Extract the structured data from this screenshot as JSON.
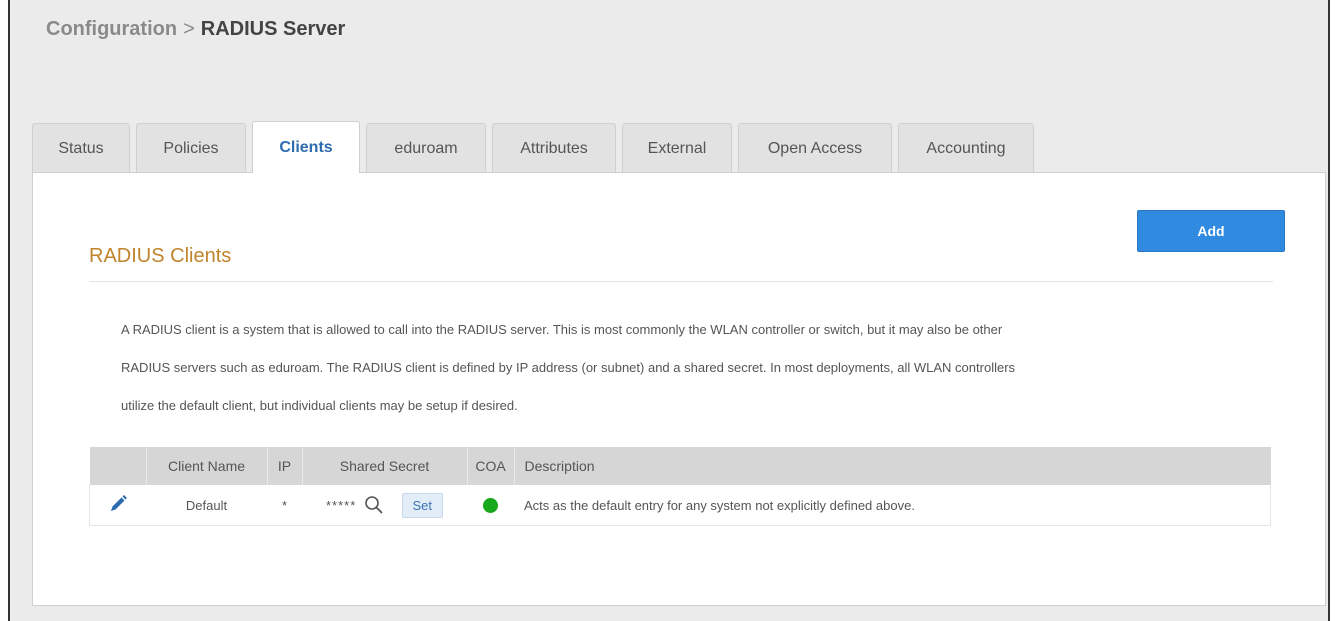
{
  "breadcrumb": {
    "parent": "Configuration",
    "separator": ">",
    "current": "RADIUS Server"
  },
  "tabs": [
    {
      "label": "Status",
      "active": false
    },
    {
      "label": "Policies",
      "active": false
    },
    {
      "label": "Clients",
      "active": true
    },
    {
      "label": "eduroam",
      "active": false
    },
    {
      "label": "Attributes",
      "active": false
    },
    {
      "label": "External",
      "active": false
    },
    {
      "label": "Open Access",
      "active": false
    },
    {
      "label": "Accounting",
      "active": false
    }
  ],
  "panel": {
    "add_label": "Add",
    "title": "RADIUS Clients",
    "description": [
      "A RADIUS client is a system that is allowed to call into the RADIUS server. This is most commonly the WLAN controller or switch, but it may also be other",
      "RADIUS servers such as eduroam. The RADIUS client is defined by IP address (or subnet) and a shared secret. In most deployments, all WLAN controllers",
      "utilize the default client, but individual clients may be setup if desired."
    ]
  },
  "table": {
    "headers": {
      "edit": "",
      "client_name": "Client Name",
      "ip": "IP",
      "shared_secret": "Shared Secret",
      "coa": "COA",
      "description": "Description"
    },
    "rows": [
      {
        "client_name": "Default",
        "ip": "*",
        "shared_secret_mask": "*****",
        "set_label": "Set",
        "coa_status": "enabled",
        "description": "Acts as the default entry for any system not explicitly defined above."
      }
    ]
  },
  "colors": {
    "accent_blue": "#2f8ae0",
    "tab_active_text": "#2c6bb0",
    "section_title": "#c0842a",
    "coa_enabled": "#17a81b"
  },
  "icons": {
    "edit": "pencil-icon",
    "reveal": "magnifier-icon",
    "coa": "status-dot-icon"
  }
}
